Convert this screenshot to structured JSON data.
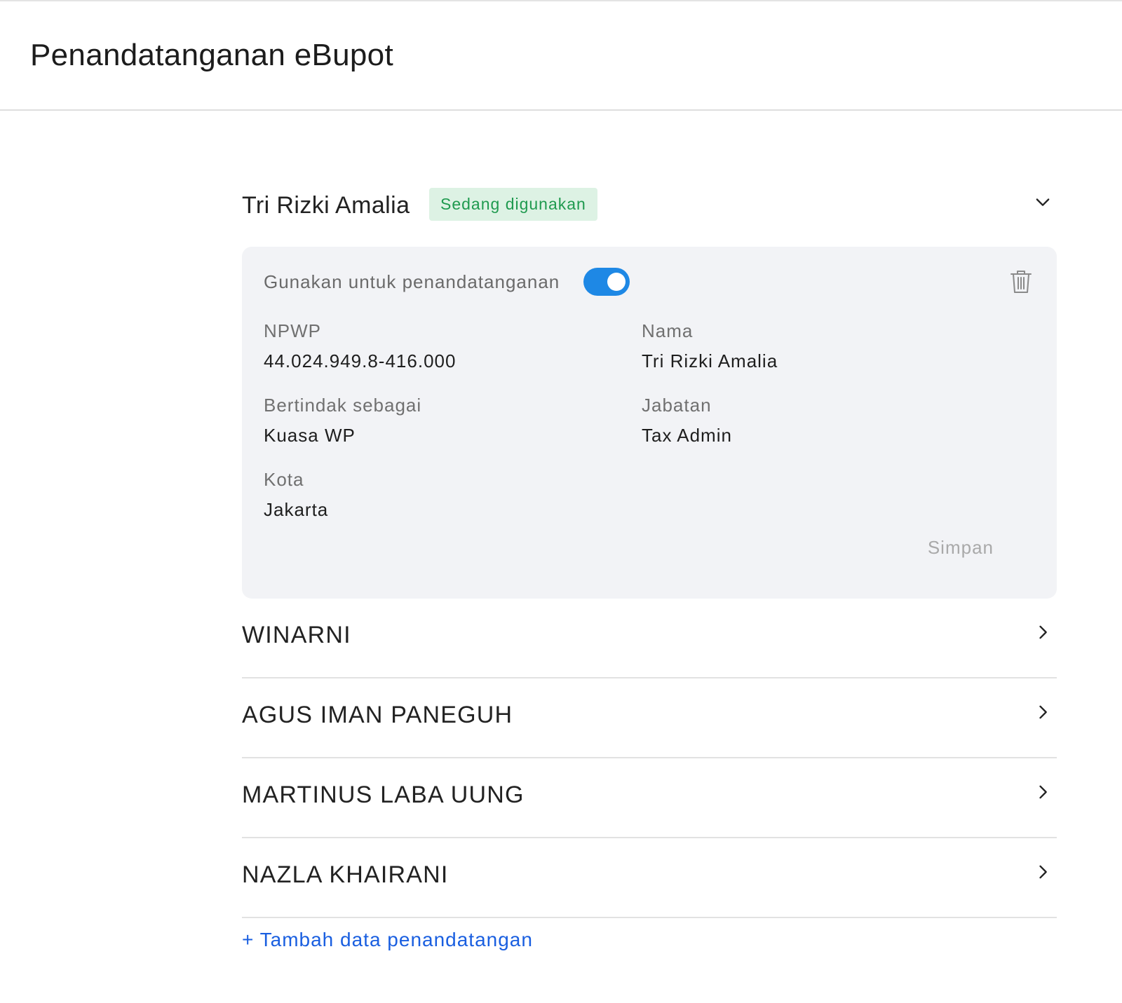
{
  "page": {
    "title": "Penandatanganan eBupot"
  },
  "active_signer": {
    "name": "Tri Rizki Amalia",
    "badge": "Sedang digunakan",
    "use_for_signing_label": "Gunakan untuk penandatanganan",
    "use_for_signing_enabled": true,
    "fields": {
      "npwp_label": "NPWP",
      "npwp_value": "44.024.949.8-416.000",
      "nama_label": "Nama",
      "nama_value": "Tri Rizki Amalia",
      "role_label": "Bertindak sebagai",
      "role_value": "Kuasa WP",
      "jabatan_label": "Jabatan",
      "jabatan_value": "Tax Admin",
      "kota_label": "Kota",
      "kota_value": "Jakarta"
    },
    "save_label": "Simpan"
  },
  "other_signers": [
    {
      "name": "WINARNI"
    },
    {
      "name": "AGUS IMAN PANEGUH"
    },
    {
      "name": "MARTINUS LABA UUNG"
    },
    {
      "name": "NAZLA KHAIRANI"
    }
  ],
  "add_signer_label": "+ Tambah data penandatangan",
  "colors": {
    "toggle_on": "#1e88e5",
    "badge_bg": "#ddf2e4",
    "badge_text": "#1f9a4f",
    "link": "#1a5fe0",
    "card_bg": "#f2f3f6"
  },
  "icons": {
    "collapse": "chevron-down-icon",
    "expand": "chevron-right-icon",
    "delete": "trash-icon"
  }
}
